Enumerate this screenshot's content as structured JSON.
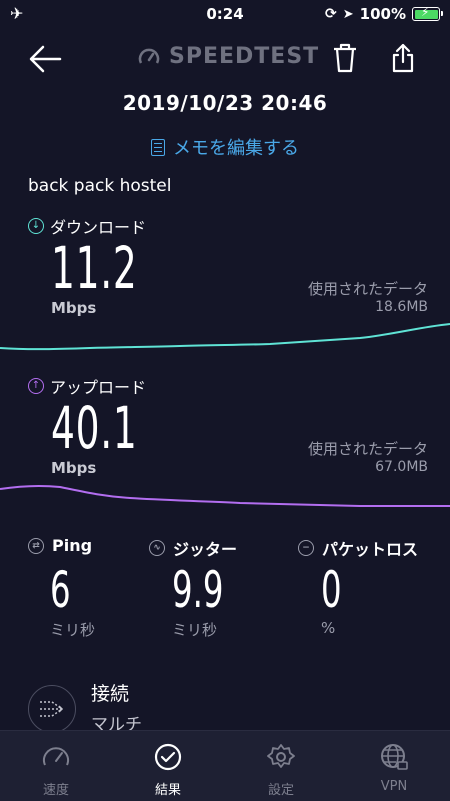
{
  "status_bar": {
    "time": "0:24",
    "battery": "100%"
  },
  "header": {
    "logo_text": "SPEEDTEST"
  },
  "result": {
    "datetime": "2019/10/23 20:46",
    "memo_link": "メモを編集する",
    "server": "back pack hostel"
  },
  "download": {
    "label": "ダウンロード",
    "value": "11.2",
    "unit": "Mbps",
    "data_label": "使用されたデータ",
    "data_value": "18.6MB",
    "color": "#5fe3d5"
  },
  "upload": {
    "label": "アップロード",
    "value": "40.1",
    "unit": "Mbps",
    "data_label": "使用されたデータ",
    "data_value": "67.0MB",
    "color": "#b36ef0"
  },
  "stats": {
    "ping": {
      "label": "Ping",
      "value": "6",
      "unit": "ミリ秒"
    },
    "jitter": {
      "label": "ジッター",
      "value": "9.9",
      "unit": "ミリ秒"
    },
    "packet_loss": {
      "label": "パケットロス",
      "value": "0",
      "unit": "%"
    }
  },
  "connection": {
    "title": "接続",
    "value": "マルチ"
  },
  "tabs": [
    {
      "label": "速度",
      "icon": "speedometer-icon"
    },
    {
      "label": "結果",
      "icon": "check-circle-icon"
    },
    {
      "label": "設定",
      "icon": "gear-icon"
    },
    {
      "label": "VPN",
      "icon": "globe-lock-icon"
    }
  ]
}
